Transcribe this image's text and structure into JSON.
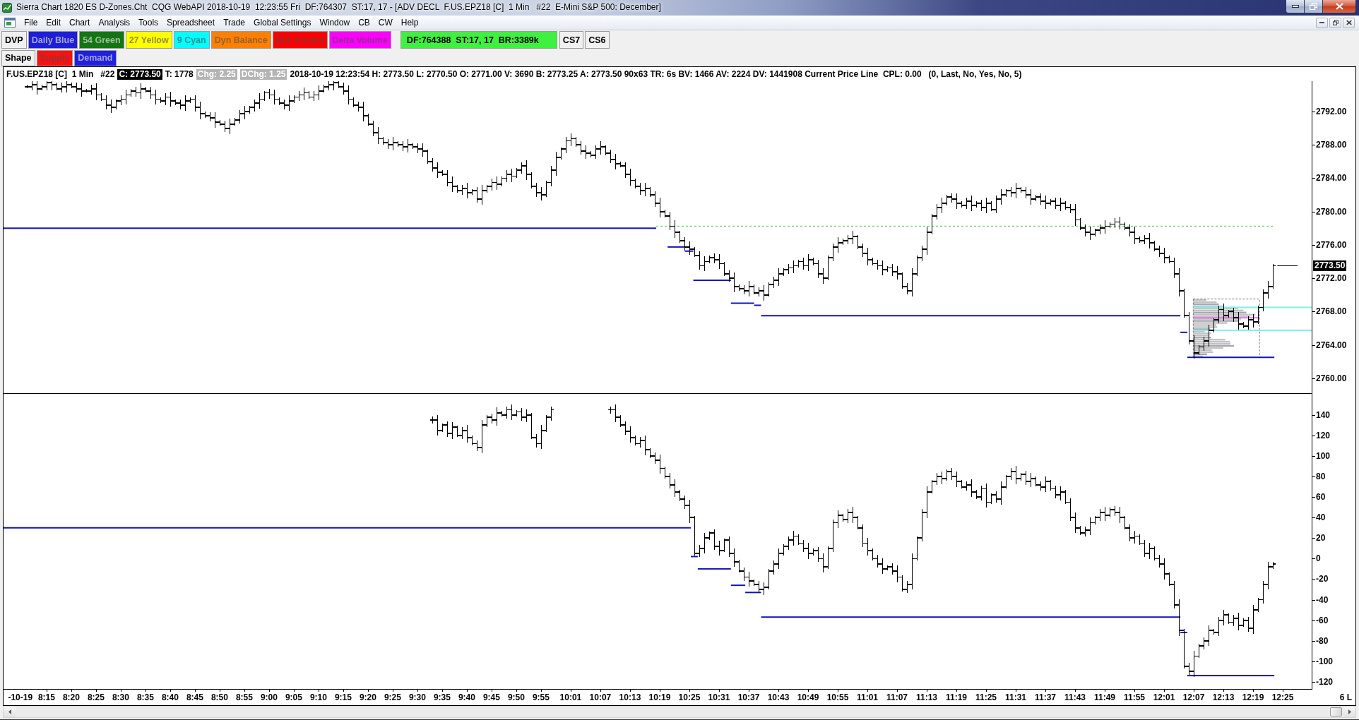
{
  "window": {
    "title": "Sierra Chart 1820 ES D-Zones.Cht  CQG WebAPI 2018-10-19  12:23:55 Fri  DF:764307  ST:17, 17 - [ADV DECL  F.US.EPZ18 [C]  1 Min   #22  E-Mini S&P 500: December]"
  },
  "menu": [
    "File",
    "Edit",
    "Chart",
    "Analysis",
    "Tools",
    "Spreadsheet",
    "Trade",
    "Global Settings",
    "Window",
    "CB",
    "CW",
    "Help"
  ],
  "toolbar": [
    {
      "label": "DVP",
      "kind": "button",
      "color": "#f0f0f0"
    },
    {
      "label": "Daily Blue",
      "kind": "button",
      "color": "#1e1ed8"
    },
    {
      "label": "54 Green",
      "kind": "button",
      "color": "#137613"
    },
    {
      "label": "27 Yellow",
      "kind": "button",
      "color": "#ffff00"
    },
    {
      "label": "9 Cyan",
      "kind": "button",
      "color": "#00ffff"
    },
    {
      "label": "Dyn Balance",
      "kind": "button",
      "color": "#ff8000"
    },
    {
      "label": "Bid Volume",
      "kind": "button",
      "color": "#ff0000"
    },
    {
      "label": "Delta Volume",
      "kind": "button",
      "color": "#ff00ff"
    },
    {
      "label": "DF:764388  ST:17, 17  BR:3389k",
      "kind": "display",
      "color": "#40f040"
    },
    {
      "label": "CS7",
      "kind": "button",
      "color": "#f0f0f0"
    },
    {
      "label": "CS6",
      "kind": "button",
      "color": "#f0f0f0"
    }
  ],
  "toolbar_2": [
    {
      "label": "Shape",
      "kind": "button",
      "color": "#f0f0f0"
    },
    {
      "label": "Supply",
      "kind": "button",
      "color": "#ff1010"
    },
    {
      "label": "Demand",
      "kind": "button",
      "color": "#2020e0"
    }
  ],
  "chart": {
    "header": [
      {
        "text": "F.US.EPZ18 [C]  1 Min   #22",
        "kind": "plain"
      },
      {
        "text": "C: 2773.50",
        "kind": "inverse"
      },
      {
        "text": "T: 1778",
        "kind": "plain"
      },
      {
        "text": "Chg: 2.25",
        "kind": "muted"
      },
      {
        "text": "DChg: 1.25",
        "kind": "muted"
      },
      {
        "text": "2018-10-19 12:23:54 H: 2773.50 L: 2770.50 O: 2771.00 V: 3690 B: 2773.25 A: 2773.50 90x63 TR: 6s BV: 1466 AV: 2224 DV: 1441908 Current Price Line  CPL: 0.00   (0, Last, No, Yes, No, 5)",
        "kind": "plain"
      }
    ],
    "price_panel": {
      "axis_labels": [
        "2792.00",
        "2788.00",
        "2784.00",
        "2780.00",
        "2776.00",
        "2772.00",
        "2768.00",
        "2764.00",
        "2760.00"
      ],
      "current_price": "2773.50"
    },
    "indicator_panel": {
      "axis_labels": [
        "140",
        "120",
        "100",
        "80",
        "60",
        "40",
        "20",
        "0",
        "-20",
        "-40",
        "-60",
        "-80",
        "-100",
        "-120"
      ]
    },
    "time_axis": {
      "labels": [
        "-10-19",
        "8:15",
        "8:20",
        "8:25",
        "8:30",
        "8:35",
        "8:40",
        "8:45",
        "8:50",
        "8:55",
        "9:00",
        "9:05",
        "9:10",
        "9:15",
        "9:20",
        "9:25",
        "9:30",
        "9:35",
        "9:40",
        "9:45",
        "9:50",
        "9:55",
        "10:01",
        "10:07",
        "10:13",
        "10:19",
        "10:25",
        "10:31",
        "10:37",
        "10:43",
        "10:49",
        "10:55",
        "11:01",
        "11:07",
        "11:13",
        "11:19",
        "11:25",
        "11:31",
        "11:37",
        "11:43",
        "11:49",
        "11:55",
        "12:01",
        "12:07",
        "12:13",
        "12:19",
        "12:25"
      ],
      "corner_label": "6 L"
    }
  }
}
